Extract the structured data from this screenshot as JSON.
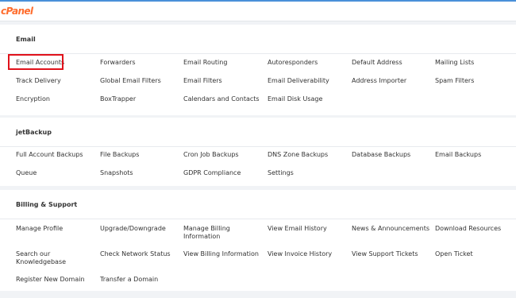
{
  "brand": {
    "logo_text": "cPanel",
    "logo_color": "#ff6c2c"
  },
  "colors": {
    "highlight_border": "#e0121b",
    "accent": "#4a90d9"
  },
  "sections": {
    "email": {
      "title": "Email",
      "items": [
        "Email Accounts",
        "Forwarders",
        "Email Routing",
        "Autoresponders",
        "Default Address",
        "Mailing Lists",
        "Track Delivery",
        "Global Email Filters",
        "Email Filters",
        "Email Deliverability",
        "Address Importer",
        "Spam Filters",
        "Encryption",
        "BoxTrapper",
        "Calendars and Contacts",
        "Email Disk Usage"
      ],
      "highlighted_item": "Email Accounts"
    },
    "jetbackup": {
      "title": "jetBackup",
      "items": [
        "Full Account Backups",
        "File Backups",
        "Cron Job Backups",
        "DNS Zone Backups",
        "Database Backups",
        "Email Backups",
        "Queue",
        "Snapshots",
        "GDPR Compliance",
        "Settings"
      ]
    },
    "billing": {
      "title": "Billing & Support",
      "items": [
        "Manage Profile",
        "Upgrade/Downgrade",
        "Manage Billing Information",
        "View Email History",
        "News & Announcements",
        "Download Resources",
        "Search our Knowledgebase",
        "Check Network Status",
        "View Billing Information",
        "View Invoice History",
        "View Support Tickets",
        "Open Ticket",
        "Register New Domain",
        "Transfer a Domain"
      ]
    }
  }
}
